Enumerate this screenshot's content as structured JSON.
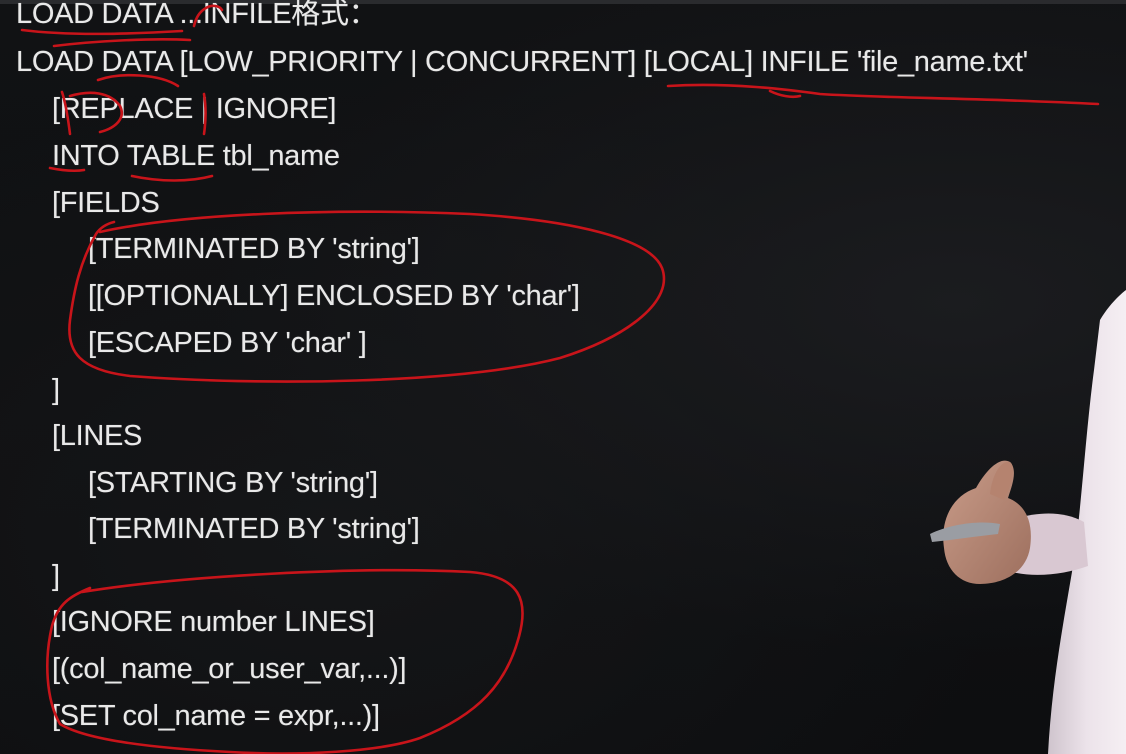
{
  "slide": {
    "lines": [
      "LOAD DATA ...INFILE格式：",
      "LOAD DATA [LOW_PRIORITY | CONCURRENT] [LOCAL] INFILE 'file_name.txt'",
      "[REPLACE | IGNORE]",
      "INTO TABLE tbl_name",
      "[FIELDS",
      "[TERMINATED BY 'string']",
      "[[OPTIONALLY] ENCLOSED BY 'char']",
      "[ESCAPED BY 'char' ]",
      "]",
      "[LINES",
      "[STARTING BY 'string']",
      "[TERMINATED BY 'string']",
      "]",
      "[IGNORE number LINES]",
      "[(col_name_or_user_var,...)]",
      "[SET col_name = expr,...)]"
    ]
  },
  "colors": {
    "background": "#0d0e10",
    "text": "#e9e9e9",
    "annotation": "#c8141a",
    "shirt": "#e9dfe6",
    "skin": "#b98a78"
  }
}
